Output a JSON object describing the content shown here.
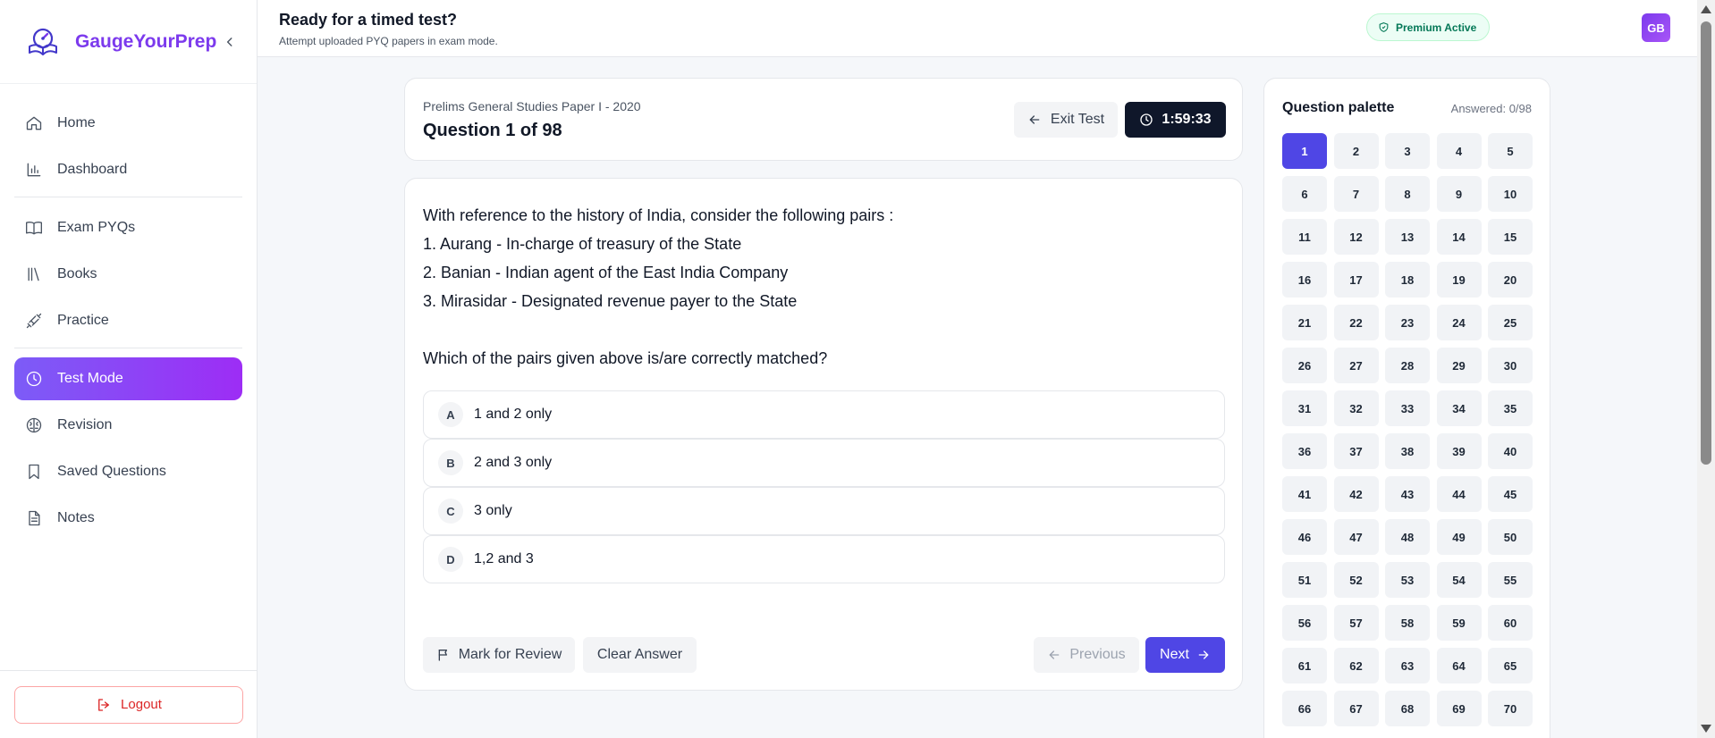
{
  "brand": {
    "name": "GaugeYourPrep"
  },
  "sidebar": {
    "items": [
      {
        "label": "Home",
        "icon": "home-icon"
      },
      {
        "label": "Dashboard",
        "icon": "bar-chart-icon"
      },
      {
        "label": "Exam PYQs",
        "icon": "open-book-icon"
      },
      {
        "label": "Books",
        "icon": "library-icon"
      },
      {
        "label": "Practice",
        "icon": "dumbbell-icon"
      },
      {
        "label": "Test Mode",
        "icon": "clock-icon",
        "active": true
      },
      {
        "label": "Revision",
        "icon": "brain-icon"
      },
      {
        "label": "Saved Questions",
        "icon": "bookmark-icon"
      },
      {
        "label": "Notes",
        "icon": "notes-icon"
      }
    ],
    "logout_label": "Logout"
  },
  "header": {
    "title": "Ready for a timed test?",
    "subtitle": "Attempt uploaded PYQ papers in exam mode.",
    "premium_label": "Premium Active",
    "avatar_initials": "GB"
  },
  "test": {
    "paper_name": "Prelims General Studies Paper I - 2020",
    "counter": "Question 1 of 98",
    "exit_label": "Exit Test",
    "timer": "1:59:33"
  },
  "question": {
    "lines": [
      "With reference to the history of India, consider the following pairs :",
      "1. Aurang - In-charge of treasury of the State",
      "2. Banian - Indian agent of the East India Company",
      "3. Mirasidar - Designated revenue payer to the State",
      "",
      "Which of the pairs given above is/are correctly matched?"
    ],
    "options": [
      {
        "key": "A",
        "text": "1 and 2 only"
      },
      {
        "key": "B",
        "text": "2 and 3 only"
      },
      {
        "key": "C",
        "text": "3 only"
      },
      {
        "key": "D",
        "text": "1,2 and 3"
      }
    ]
  },
  "actions": {
    "mark_label": "Mark for Review",
    "clear_label": "Clear Answer",
    "prev_label": "Previous",
    "next_label": "Next"
  },
  "palette": {
    "title": "Question palette",
    "answered": "Answered: 0/98",
    "current": 1,
    "visible_numbers": [
      1,
      2,
      3,
      4,
      5,
      6,
      7,
      8,
      9,
      10,
      11,
      12,
      13,
      14,
      15,
      16,
      17,
      18,
      19,
      20,
      21,
      22,
      23,
      24,
      25,
      26,
      27,
      28,
      29,
      30,
      31,
      32,
      33,
      34,
      35,
      36,
      37,
      38,
      39,
      40,
      41,
      42,
      43,
      44,
      45,
      46,
      47,
      48,
      49,
      50,
      51,
      52,
      53,
      54,
      55,
      56,
      57,
      58,
      59,
      60,
      61,
      62,
      63,
      64,
      65,
      66,
      67,
      68,
      69,
      70
    ]
  },
  "colors": {
    "brand": "#7c3aed",
    "accent": "#4f46e5",
    "timer_bg": "#0f172a",
    "danger": "#dc2626",
    "success": "#047857"
  }
}
